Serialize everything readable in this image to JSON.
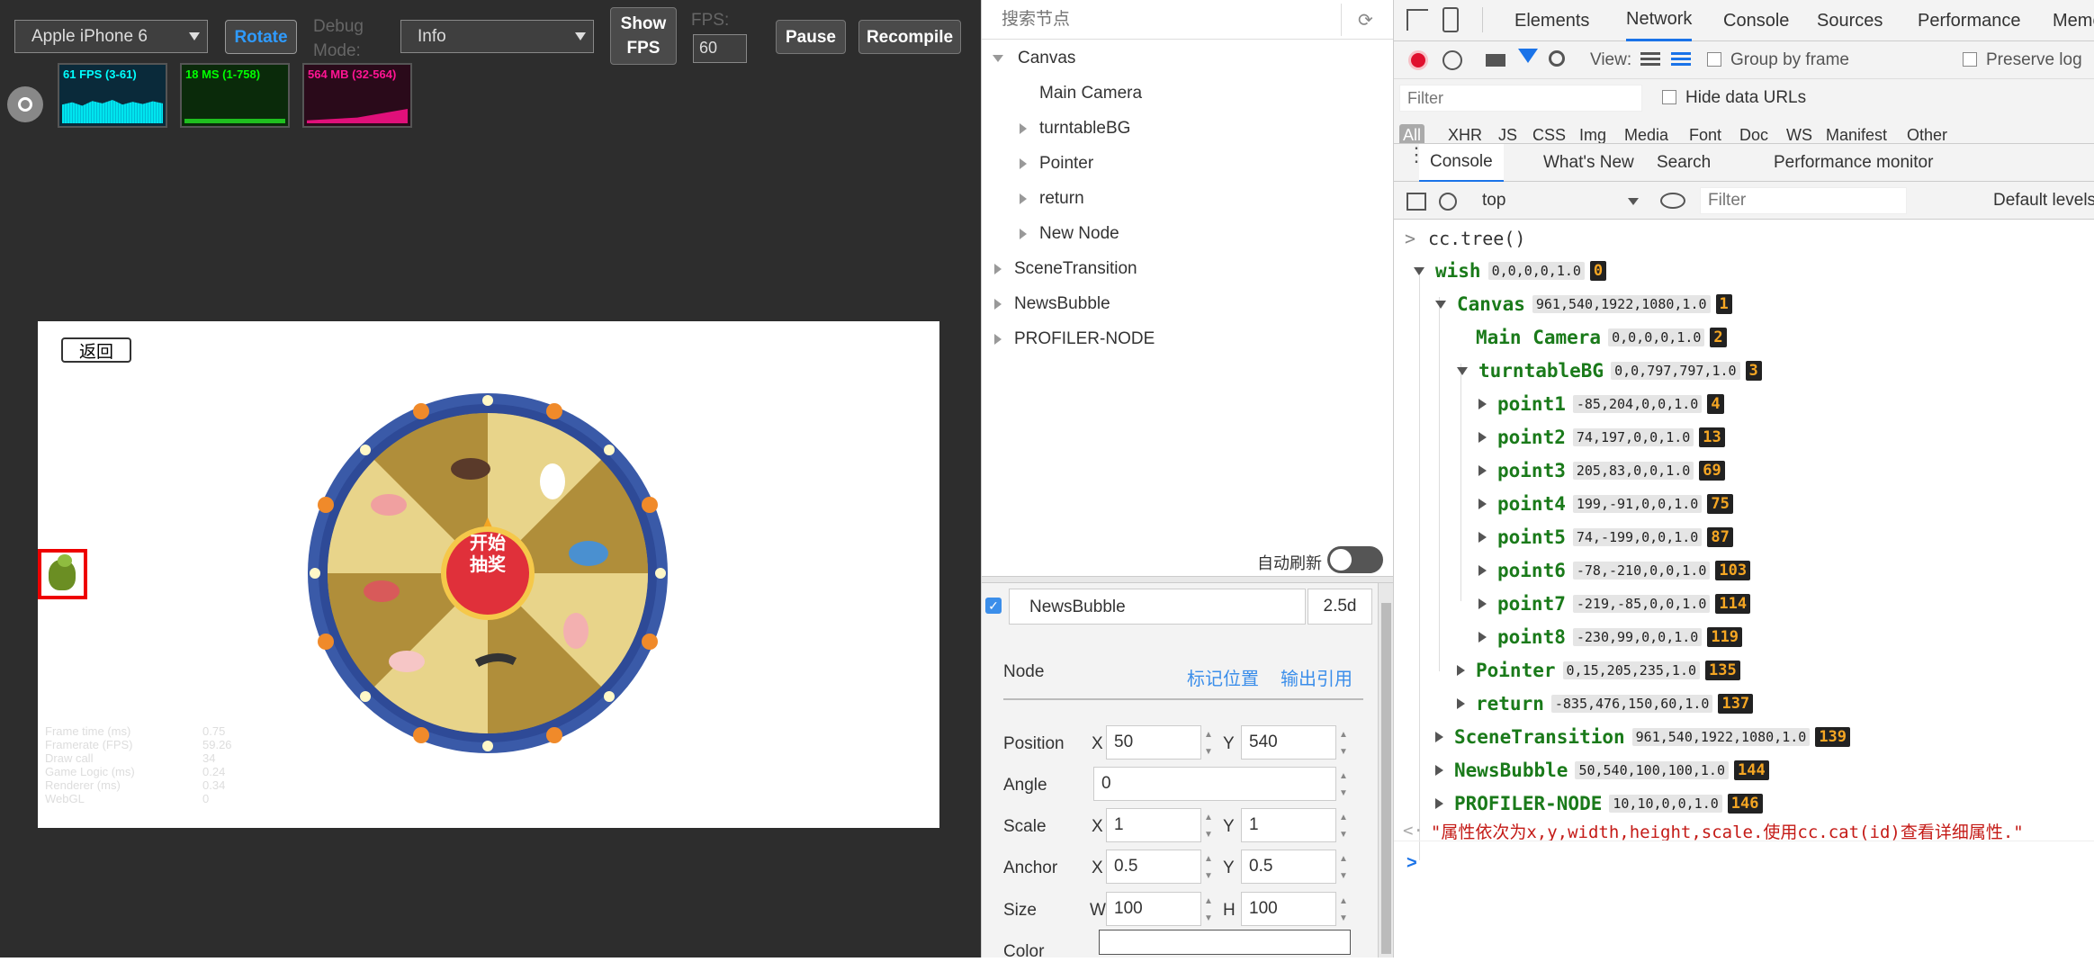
{
  "simulator": {
    "device": "Apple iPhone 6",
    "rotate": "Rotate",
    "debug_mode_label": "Debug Mode:",
    "debug_mode_value": "Info",
    "show_fps": [
      "Show",
      "FPS"
    ],
    "fps_label": "FPS:",
    "fps_value": "60",
    "pause": "Pause",
    "recompile": "Recompile",
    "stats": [
      {
        "label": "61 FPS (3-61)",
        "color": "#00ffff"
      },
      {
        "label": "18 MS (1-758)",
        "color": "#00ff00"
      },
      {
        "label": "564 MB (32-564)",
        "color": "#ff1493"
      }
    ]
  },
  "game": {
    "back_button": "返回",
    "wheel_center": [
      "开始",
      "抽奖"
    ],
    "profiler": {
      "labels": [
        "Frame time (ms)",
        "Framerate (FPS)",
        "Draw call",
        "Game Logic (ms)",
        "Renderer (ms)",
        "WebGL"
      ],
      "values": [
        "0.75",
        "59.26",
        "34",
        "0.24",
        "0.34",
        "0"
      ]
    }
  },
  "hierarchy": {
    "search_placeholder": "搜索节点",
    "nodes": [
      {
        "label": "Canvas",
        "expand": "open",
        "depth": 0
      },
      {
        "label": "Main Camera",
        "expand": "none",
        "depth": 1
      },
      {
        "label": "turntableBG",
        "expand": "closed",
        "depth": 1
      },
      {
        "label": "Pointer",
        "expand": "closed",
        "depth": 1
      },
      {
        "label": "return",
        "expand": "closed",
        "depth": 1
      },
      {
        "label": "New Node",
        "expand": "closed",
        "depth": 1
      },
      {
        "label": "SceneTransition",
        "expand": "closed",
        "depth": 0
      },
      {
        "label": "NewsBubble",
        "expand": "closed",
        "depth": 0
      },
      {
        "label": "PROFILER-NODE",
        "expand": "closed",
        "depth": 0
      }
    ],
    "auto_refresh": "自动刷新"
  },
  "inspector": {
    "node_name": "NewsBubble",
    "version": "2.5d",
    "section": "Node",
    "mark_position": "标记位置",
    "output_ref": "输出引用",
    "position": {
      "label": "Position",
      "x": "50",
      "y": "540"
    },
    "angle": {
      "label": "Angle",
      "value": "0"
    },
    "scale": {
      "label": "Scale",
      "x": "1",
      "y": "1"
    },
    "anchor": {
      "label": "Anchor",
      "x": "0.5",
      "y": "0.5"
    },
    "size": {
      "label": "Size",
      "w": "100",
      "h": "100"
    },
    "color": {
      "label": "Color"
    },
    "axis": {
      "x": "X",
      "y": "Y",
      "w": "W",
      "h": "H"
    }
  },
  "devtools": {
    "tabs": [
      "Elements",
      "Network",
      "Console",
      "Sources",
      "Performance",
      "Memo"
    ],
    "active_tab": "Network",
    "network": {
      "view_label": "View:",
      "group_by_frame": "Group by frame",
      "preserve_log": "Preserve log",
      "filter_placeholder": "Filter",
      "hide_data_urls": "Hide data URLs",
      "types": [
        "All",
        "XHR",
        "JS",
        "CSS",
        "Img",
        "Media",
        "Font",
        "Doc",
        "WS",
        "Manifest",
        "Other"
      ]
    },
    "drawer_tabs": [
      "Console",
      "What's New",
      "Search",
      "Performance monitor"
    ],
    "console_context": "top",
    "console_filter_placeholder": "Filter",
    "default_levels": "Default levels",
    "command": "cc.tree()",
    "tree": [
      {
        "name": "wish",
        "attrs": "0,0,0,0,1.0",
        "id": "0",
        "depth": 0,
        "expand": "open"
      },
      {
        "name": "Canvas",
        "attrs": "961,540,1922,1080,1.0",
        "id": "1",
        "depth": 1,
        "expand": "open"
      },
      {
        "name": "Main Camera",
        "attrs": "0,0,0,0,1.0",
        "id": "2",
        "depth": 2,
        "expand": "none"
      },
      {
        "name": "turntableBG",
        "attrs": "0,0,797,797,1.0",
        "id": "3",
        "depth": 2,
        "expand": "open"
      },
      {
        "name": "point1",
        "attrs": "-85,204,0,0,1.0",
        "id": "4",
        "depth": 3,
        "expand": "closed"
      },
      {
        "name": "point2",
        "attrs": "74,197,0,0,1.0",
        "id": "13",
        "depth": 3,
        "expand": "closed"
      },
      {
        "name": "point3",
        "attrs": "205,83,0,0,1.0",
        "id": "69",
        "depth": 3,
        "expand": "closed"
      },
      {
        "name": "point4",
        "attrs": "199,-91,0,0,1.0",
        "id": "75",
        "depth": 3,
        "expand": "closed"
      },
      {
        "name": "point5",
        "attrs": "74,-199,0,0,1.0",
        "id": "87",
        "depth": 3,
        "expand": "closed"
      },
      {
        "name": "point6",
        "attrs": "-78,-210,0,0,1.0",
        "id": "103",
        "depth": 3,
        "expand": "closed"
      },
      {
        "name": "point7",
        "attrs": "-219,-85,0,0,1.0",
        "id": "114",
        "depth": 3,
        "expand": "closed"
      },
      {
        "name": "point8",
        "attrs": "-230,99,0,0,1.0",
        "id": "119",
        "depth": 3,
        "expand": "closed"
      },
      {
        "name": "Pointer",
        "attrs": "0,15,205,235,1.0",
        "id": "135",
        "depth": 2,
        "expand": "closed"
      },
      {
        "name": "return",
        "attrs": "-835,476,150,60,1.0",
        "id": "137",
        "depth": 2,
        "expand": "closed"
      },
      {
        "name": "SceneTransition",
        "attrs": "961,540,1922,1080,1.0",
        "id": "139",
        "depth": 1,
        "expand": "closed"
      },
      {
        "name": "NewsBubble",
        "attrs": "50,540,100,100,1.0",
        "id": "144",
        "depth": 1,
        "expand": "closed"
      },
      {
        "name": "PROFILER-NODE",
        "attrs": "10,10,0,0,1.0",
        "id": "146",
        "depth": 1,
        "expand": "closed"
      }
    ],
    "result_text": "\"属性依次为x,y,width,height,scale.使用cc.cat(id)查看详细属性.\""
  }
}
